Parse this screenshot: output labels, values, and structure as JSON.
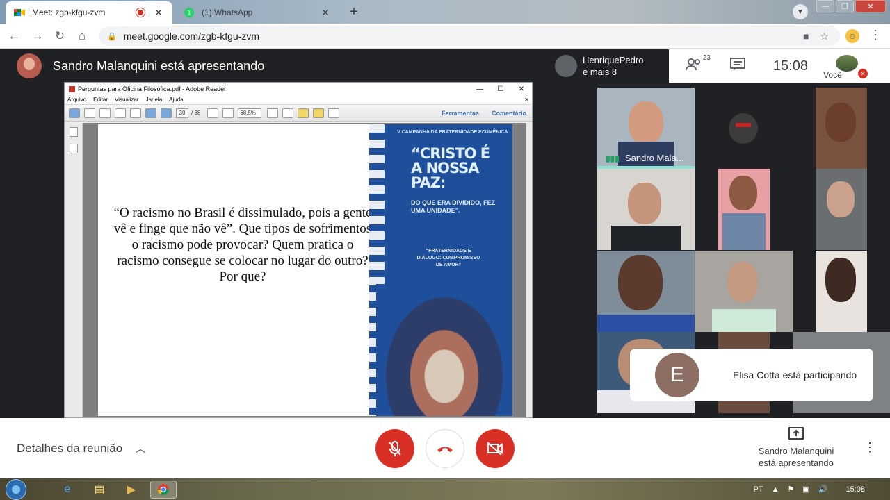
{
  "browser": {
    "tabs": [
      {
        "title": "Meet: zgb-kfgu-zvm",
        "active": true,
        "icon": "meet-icon",
        "recording": true
      },
      {
        "title": "(1) WhatsApp",
        "active": false,
        "icon": "whatsapp-icon"
      }
    ],
    "url": "meet.google.com/zgb-kfgu-zvm"
  },
  "meet": {
    "presenter_title": "Sandro Malanquini está apresentando",
    "people_group": {
      "line1": "HenriquePedro",
      "line2": "e mais 8"
    },
    "participant_count": "23",
    "time": "15:08",
    "self_label": "Você",
    "speaking_name": "Sandro Mala...",
    "toast": {
      "avatar_letter": "E",
      "message": "Elisa Cotta está participando"
    },
    "controls": {
      "details_label": "Detalhes da reunião",
      "presenting_line1": "Sandro Malanquini",
      "presenting_line2": "está apresentando"
    }
  },
  "reader": {
    "title": "Perguntas para Oficina Filosófica.pdf - Adobe Reader",
    "menu": [
      "Arquivo",
      "Editar",
      "Visualizar",
      "Janela",
      "Ajuda"
    ],
    "page_current": "30",
    "page_total": "/ 38",
    "zoom": "68,5%",
    "links": [
      "Ferramentas",
      "Comentário"
    ],
    "slide_text": "“O racismo no Brasil é dissimulado, pois a gente vê e finge que não vê”. Que tipos de sofrimentos o racismo pode provocar? Quem pratica o racismo consegue se colocar no lugar do outro? Por que?",
    "poster": {
      "header": "V CAMPANHA DA FRATERNIDADE ECUMÊNICA",
      "title": "“CRISTO É A NOSSA PAZ:",
      "subtitle": "DO QUE ERA DIVIDIDO, FEZ UMA UNIDADE”.",
      "theme": "“FRATERNIDADE E DIÁLOGO: COMPROMISSO DE AMOR”"
    }
  },
  "taskbar": {
    "language": "PT",
    "time": "15:08"
  },
  "colors": {
    "danger": "#d93025",
    "meet_dark": "#202124",
    "speaking": "#1ea362"
  }
}
